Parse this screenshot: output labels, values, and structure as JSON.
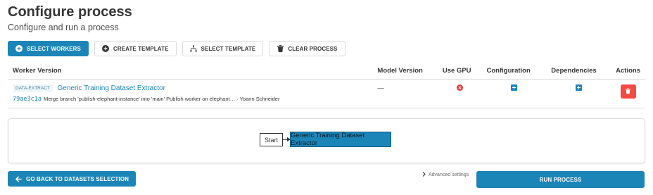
{
  "header": {
    "title": "Configure process",
    "subtitle": "Configure and run a process"
  },
  "toolbar": {
    "select_workers": "SELECT WORKERS",
    "create_template": "CREATE TEMPLATE",
    "select_template": "SELECT TEMPLATE",
    "clear_process": "CLEAR PROCESS"
  },
  "table": {
    "headers": {
      "worker_version": "Worker Version",
      "model_version": "Model Version",
      "use_gpu": "Use GPU",
      "configuration": "Configuration",
      "dependencies": "Dependencies",
      "actions": "Actions"
    },
    "rows": [
      {
        "tag": "DATA-EXTRACT",
        "worker_name": "Generic Training Dataset Extractor",
        "revision_hash": "79ae3c1a",
        "revision_message": "Merge branch 'publish-elephant-instance' into 'main' Publish worker on elephant… · Yoann Schneider",
        "model_version": "—",
        "gpu_icon": "x-circle-icon",
        "configuration_icon": "plus-square-icon",
        "dependencies_icon": "plus-square-icon",
        "action_icon": "trash-icon"
      }
    ]
  },
  "graph": {
    "start_label": "Start",
    "worker_node_label": "Generic Training Dataset Extractor"
  },
  "footer": {
    "back_label": "GO BACK TO DATASETS SELECTION",
    "advanced_label": "Advanced settings",
    "run_label": "RUN PROCESS"
  },
  "colors": {
    "primary": "#1b85b8",
    "danger": "#f14b42",
    "gpu_off": "#e53935"
  }
}
